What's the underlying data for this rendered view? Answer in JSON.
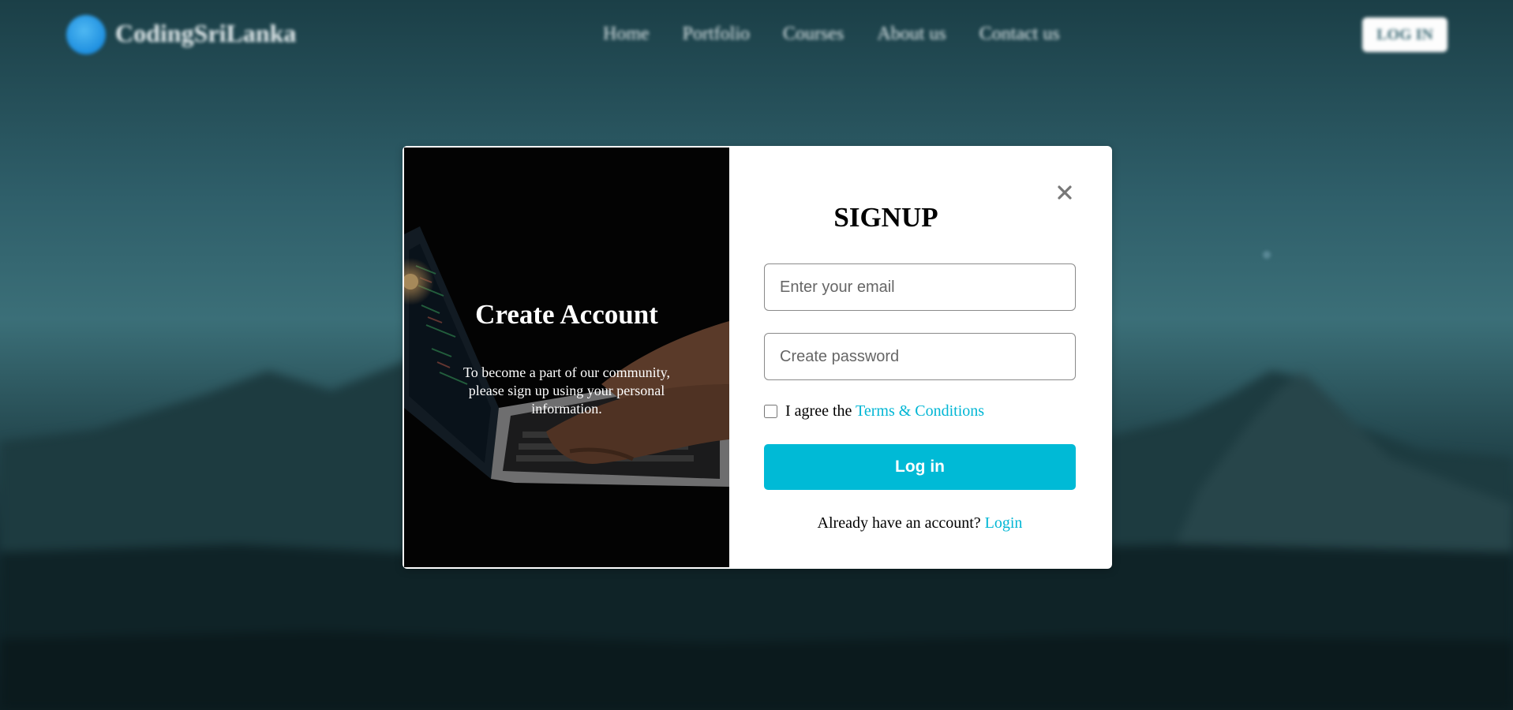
{
  "header": {
    "brand": "CodingSriLanka",
    "nav": [
      "Home",
      "Portfolio",
      "Courses",
      "About us",
      "Contact us"
    ],
    "login_label": "LOG IN"
  },
  "modal": {
    "left": {
      "title": "Create Account",
      "description": "To become a part of our community, please sign up using your personal information."
    },
    "right": {
      "title": "SIGNUP",
      "email_placeholder": "Enter your email",
      "password_placeholder": "Create password",
      "agree_text": "I agree the",
      "terms_link": "Terms & Conditions",
      "submit_label": "Log in",
      "switch_text": "Already have an account?",
      "switch_link": "Login"
    }
  },
  "colors": {
    "accent": "#00b9d6",
    "brand_logo": "#2a9ee8"
  }
}
